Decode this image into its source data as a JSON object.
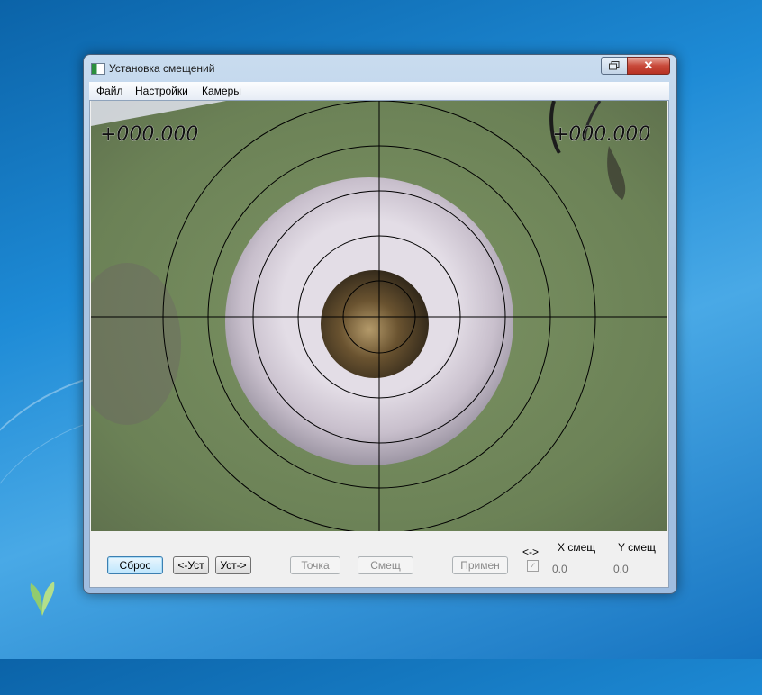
{
  "window": {
    "title": "Установка смещений"
  },
  "menu": {
    "items": [
      "Файл",
      "Настройки",
      "Камеры"
    ]
  },
  "camera": {
    "x_readout": "+000.000",
    "y_readout": "+000.000"
  },
  "controls": {
    "reset_label": "Сброс",
    "set_left_label": "<-Уст",
    "set_right_label": "Уст->",
    "point_label": "Точка",
    "offset_label": "Смещ",
    "apply_label": "Примен",
    "swap_label": "<->",
    "swap_checked": true,
    "x_offset_header": "X смещ",
    "y_offset_header": "Y смещ",
    "x_offset_value": "0.0",
    "y_offset_value": "0.0"
  },
  "colors": {
    "board_green": "#6b8156",
    "ring_silver": "#cfc6d2",
    "hole_dark": "#5a4527",
    "crosshair": "#000000",
    "close_red": "#c8493a"
  }
}
